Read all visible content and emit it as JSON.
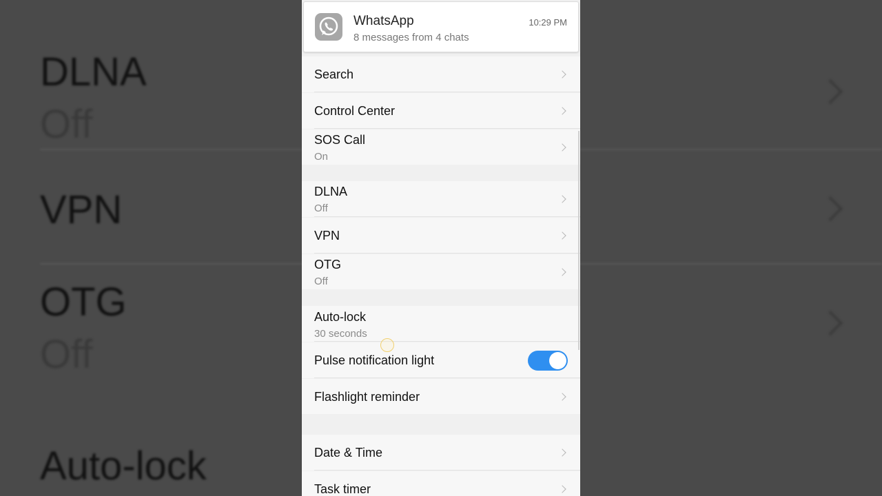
{
  "background": {
    "items": [
      {
        "label": "DLNA",
        "sub": "Off"
      },
      {
        "label": "VPN"
      },
      {
        "label": "OTG",
        "sub": "Off"
      },
      {
        "label": "Auto-lock"
      }
    ]
  },
  "notification": {
    "app": "WhatsApp",
    "text": "8 messages from 4 chats",
    "time": "10:29 PM",
    "icon": "whatsapp-icon"
  },
  "settings": {
    "search": "Search",
    "control_center": "Control Center",
    "sos_call": {
      "label": "SOS Call",
      "value": "On"
    },
    "dlna": {
      "label": "DLNA",
      "value": "Off"
    },
    "vpn": "VPN",
    "otg": {
      "label": "OTG",
      "value": "Off"
    },
    "auto_lock": {
      "label": "Auto-lock",
      "value": "30 seconds"
    },
    "pulse_light": {
      "label": "Pulse notification light",
      "enabled": true
    },
    "flashlight_reminder": "Flashlight reminder",
    "date_time": "Date & Time",
    "task_timer": "Task timer"
  },
  "colors": {
    "toggle_on": "#2f8ff0",
    "backdrop": "#4a4a4a"
  }
}
